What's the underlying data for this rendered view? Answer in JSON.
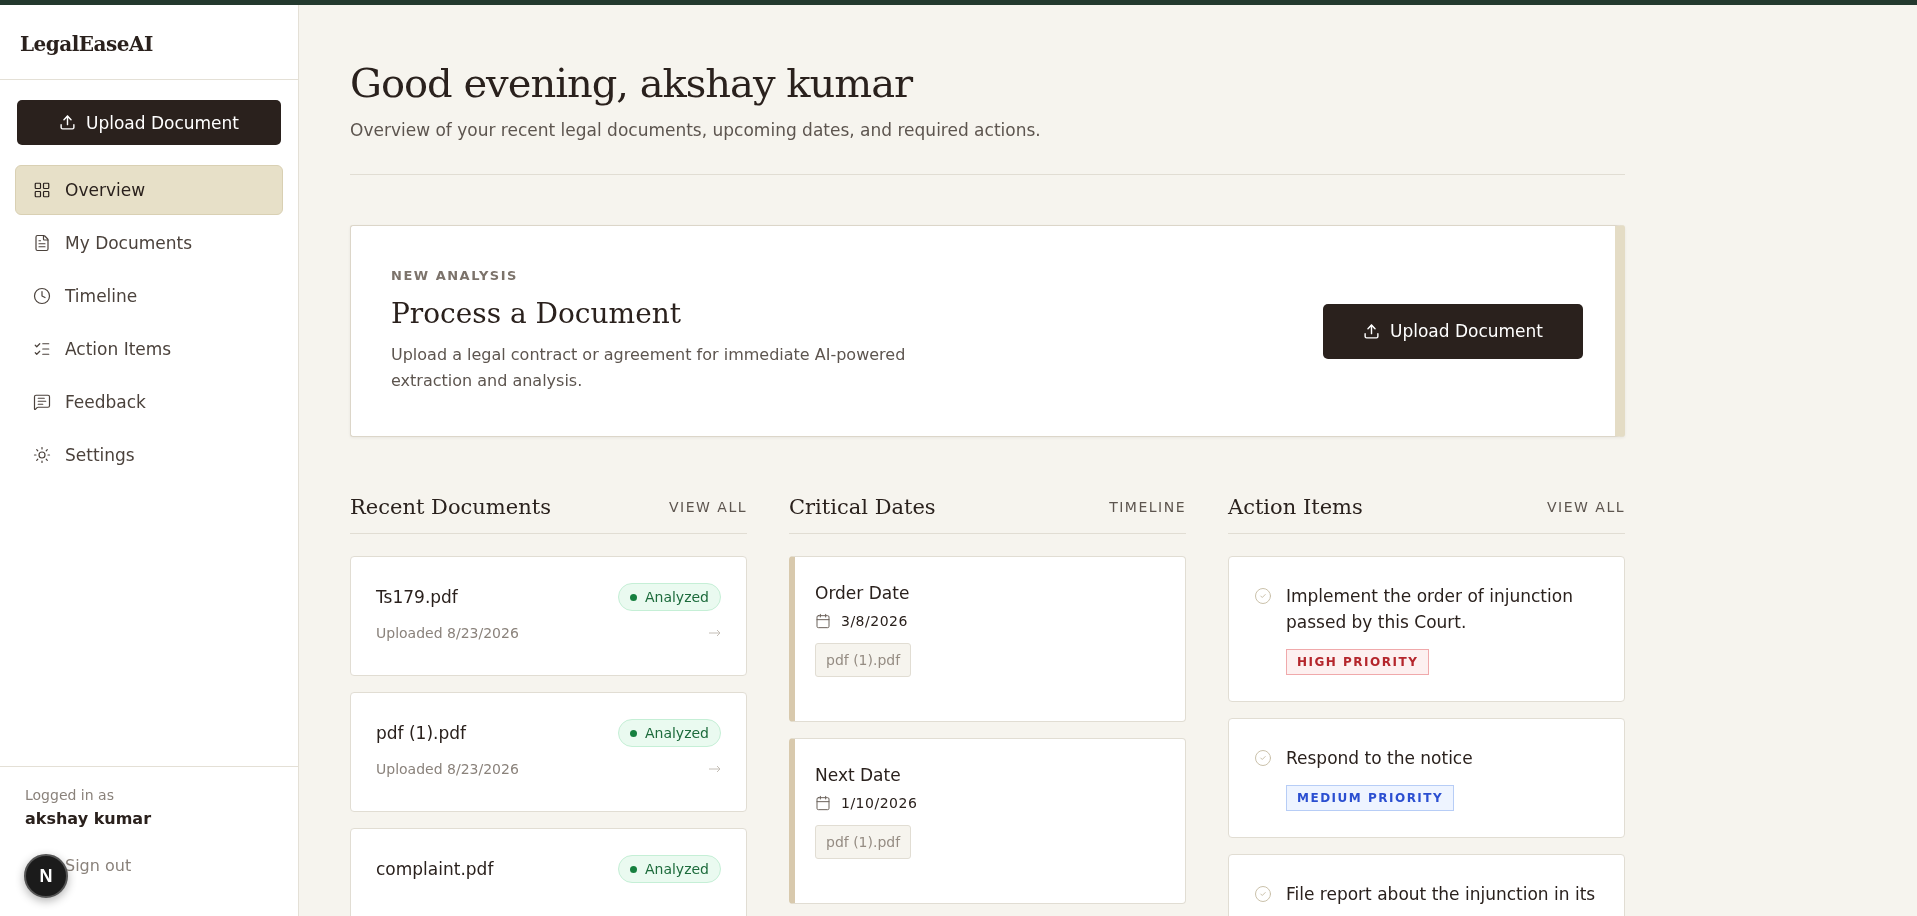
{
  "sidebar": {
    "logo": "LegalEaseAI",
    "upload_button": "Upload Document",
    "items": [
      {
        "label": "Overview",
        "selected": true
      },
      {
        "label": "My Documents",
        "selected": false
      },
      {
        "label": "Timeline",
        "selected": false
      },
      {
        "label": "Action Items",
        "selected": false
      },
      {
        "label": "Feedback",
        "selected": false
      },
      {
        "label": "Settings",
        "selected": false
      }
    ],
    "user": {
      "caption": "Logged in as",
      "name": "akshay kumar",
      "sign_out": "Sign out"
    },
    "dev_badge": "N"
  },
  "header": {
    "greeting": "Good evening, akshay kumar",
    "subtitle": "Overview of your recent legal documents, upcoming dates, and required actions."
  },
  "analysis_card": {
    "eyebrow": "NEW ANALYSIS",
    "title": "Process a Document",
    "description": "Upload a legal contract or agreement for immediate AI-powered extraction and analysis.",
    "button": "Upload Document"
  },
  "recent_documents": {
    "title": "Recent Documents",
    "link": "VIEW ALL",
    "items": [
      {
        "name": "Ts179.pdf",
        "status": "Analyzed",
        "uploaded": "Uploaded 8/23/2026"
      },
      {
        "name": "pdf (1).pdf",
        "status": "Analyzed",
        "uploaded": "Uploaded 8/23/2026"
      },
      {
        "name": "complaint.pdf",
        "status": "Analyzed"
      }
    ]
  },
  "critical_dates": {
    "title": "Critical Dates",
    "link": "TIMELINE",
    "items": [
      {
        "label": "Order Date",
        "date": "3/8/2026",
        "document": "pdf (1).pdf"
      },
      {
        "label": "Next Date",
        "date": "1/10/2026",
        "document": "pdf (1).pdf"
      }
    ]
  },
  "action_items": {
    "title": "Action Items",
    "link": "VIEW ALL",
    "items": [
      {
        "text": "Implement the order of injunction passed by this Court.",
        "priority": "HIGH PRIORITY",
        "kind": "high"
      },
      {
        "text": "Respond to the notice",
        "priority": "MEDIUM PRIORITY",
        "kind": "medium"
      },
      {
        "text": "File report about the injunction in its"
      }
    ]
  }
}
